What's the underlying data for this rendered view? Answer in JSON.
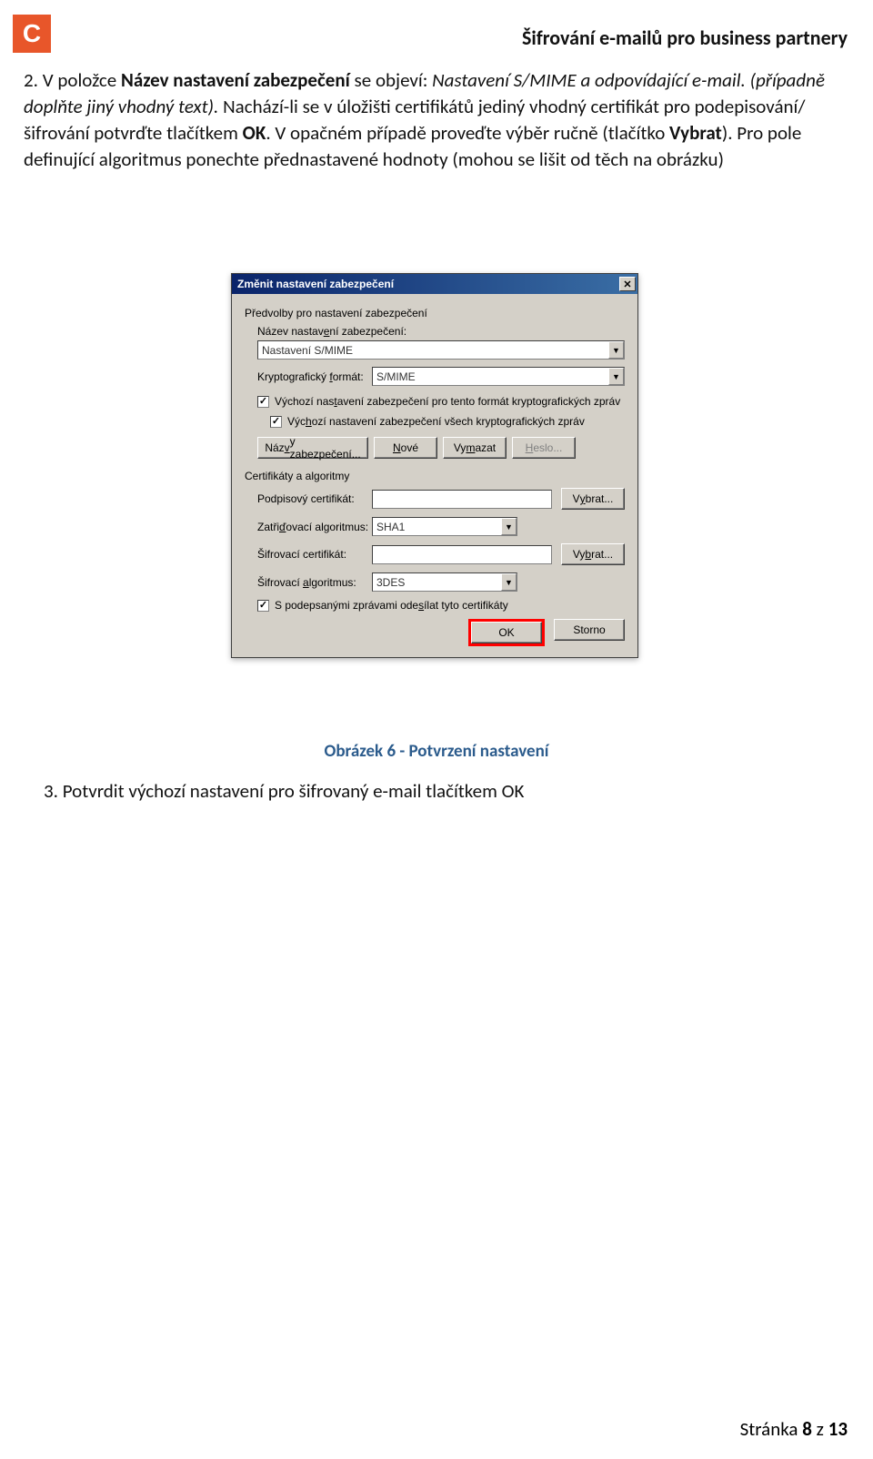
{
  "header": {
    "logo_text": "C",
    "doc_title": "Šifrování e-mailů pro business partnery"
  },
  "para": {
    "p1_prefix": "2.  V položce ",
    "p1_bold": "Název nastavení zabezpečení",
    "p1_mid": " se objeví: ",
    "p1_italic1": "Nastavení S/MIME a odpovídající e-mail. (případně doplňte jiný vhodný text).",
    "p1_tail1": " Nachází-li se v úložišti certifikátů jediný vhodný certifikát pro podepisování/šifrování potvrďte tlačítkem ",
    "p1_ok": "OK",
    "p1_tail2": ". V opačném případě proveďte výběr ručně (tlačítko ",
    "p1_vybrat": "Vybrat",
    "p1_tail3": "). Pro pole definující algoritmus ponechte přednastavené hodnoty (mohou se lišit od těch na obrázku)"
  },
  "dialog": {
    "title": "Změnit nastavení zabezpečení",
    "section1": "Předvolby pro nastavení zabezpečení",
    "name_label_pre": "Název nastav",
    "name_label_u": "e",
    "name_label_post": "ní zabezpečení:",
    "name_value": "Nastavení S/MIME",
    "format_label_pre": "Kryptografický ",
    "format_label_u": "f",
    "format_label_post": "ormát:",
    "format_value": "S/MIME",
    "cb1_pre": "Výchozí nas",
    "cb1_u": "t",
    "cb1_post": "avení zabezpečení pro tento formát kryptografických zpráv",
    "cb2_pre": "Výc",
    "cb2_u": "h",
    "cb2_post": "ozí nastavení zabezpečení všech kryptografických zpráv",
    "btn_names_pre": "Náz",
    "btn_names_u": "v",
    "btn_names_post": "y zabezpečení...",
    "btn_new_u": "N",
    "btn_new_post": "ové",
    "btn_del_pre": "Vy",
    "btn_del_u": "m",
    "btn_del_post": "azat",
    "btn_pwd_u": "H",
    "btn_pwd_post": "eslo...",
    "section2": "Certifikáty a algoritmy",
    "sign_cert_label": "Podpisový certifikát:",
    "sign_cert_val": "",
    "btn_choose1_pre": "V",
    "btn_choose1_u": "y",
    "btn_choose1_post": "brat...",
    "hash_label_pre": "Zatři",
    "hash_label_u": "ď",
    "hash_label_post": "ovací algoritmus:",
    "hash_value": "SHA1",
    "enc_cert_label": "Šifrovací certifikát:",
    "enc_cert_val": "",
    "btn_choose2_pre": "Vy",
    "btn_choose2_u": "b",
    "btn_choose2_post": "rat...",
    "enc_alg_label_pre": "Šifrovací ",
    "enc_alg_label_u": "a",
    "enc_alg_label_post": "lgoritmus:",
    "enc_alg_value": "3DES",
    "cb3_pre": "S podepsanými zprávami ode",
    "cb3_u": "s",
    "cb3_post": "ílat tyto certifikáty",
    "btn_ok": "OK",
    "btn_cancel": "Storno"
  },
  "caption": "Obrázek 6 - Potvrzení nastavení",
  "step3": {
    "prefix": "3.  Potvrdit výchozí nastavení pro šifrovaný e-mail tlačítkem ",
    "ok": "OK"
  },
  "footer": {
    "label": "Stránka ",
    "page": "8",
    "of": " z ",
    "total": "13"
  }
}
